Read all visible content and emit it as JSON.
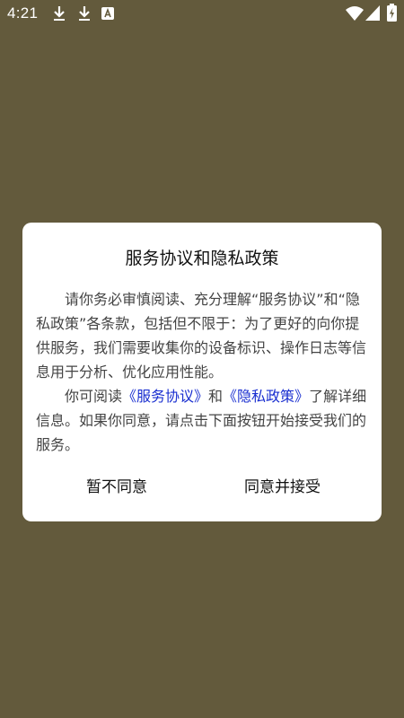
{
  "status_bar": {
    "time": "4:21",
    "icons_left": [
      "download-icon",
      "download-icon",
      "translate-badge-icon"
    ],
    "icons_right": [
      "wifi-icon",
      "signal-icon",
      "battery-charging-icon"
    ]
  },
  "dialog": {
    "title": "服务协议和隐私政策",
    "paragraph1": "请你务必审慎阅读、充分理解“服务协议”和“隐私政策”各条款，包括但不限于：为了更好的向你提供服务，我们需要收集你的设备标识、操作日志等信息用于分析、优化应用性能。",
    "paragraph2_prefix": "你可阅读",
    "service_agreement_link": "《服务协议》",
    "paragraph2_and": "和",
    "privacy_policy_link": "《隐私政策》",
    "paragraph2_suffix": "了解详细信息。如果你同意，请点击下面按钮开始接受我们的服务。",
    "decline_button": "暂不同意",
    "accept_button": "同意并接受"
  },
  "colors": {
    "background": "#635a3c",
    "dialog": "#ffffff",
    "link": "#1a2fd0"
  }
}
